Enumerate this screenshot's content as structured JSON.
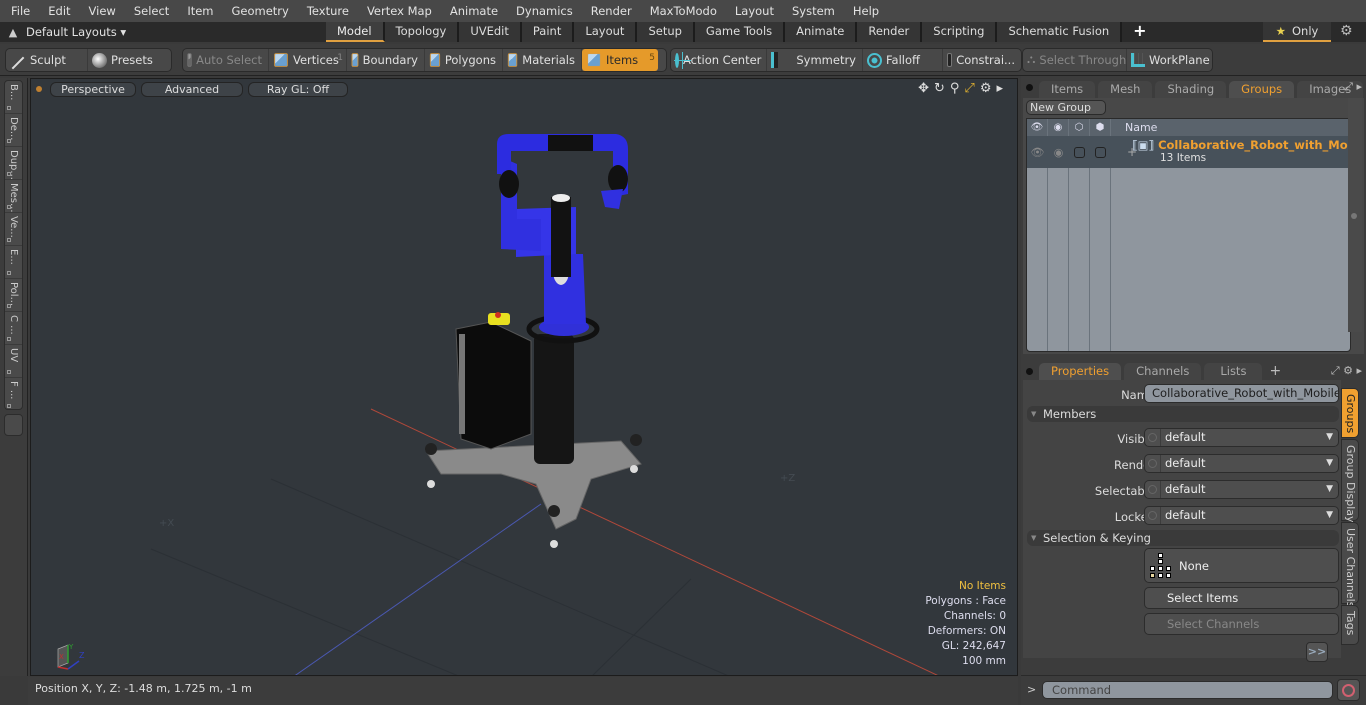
{
  "menubar": {
    "items": [
      "File",
      "Edit",
      "View",
      "Select",
      "Item",
      "Geometry",
      "Texture",
      "Vertex Map",
      "Animate",
      "Dynamics",
      "Render",
      "MaxToModo",
      "Layout",
      "System",
      "Help"
    ]
  },
  "layoutbar": {
    "layouts_label": "Default Layouts ▾",
    "tabs": [
      {
        "label": "Model",
        "active": true
      },
      {
        "label": "Topology"
      },
      {
        "label": "UVEdit"
      },
      {
        "label": "Paint"
      },
      {
        "label": "Layout"
      },
      {
        "label": "Setup"
      },
      {
        "label": "Game Tools"
      },
      {
        "label": "Animate"
      },
      {
        "label": "Render"
      },
      {
        "label": "Scripting"
      },
      {
        "label": "Schematic Fusion"
      }
    ],
    "add_tab": "+",
    "only_label": "Only",
    "star_icon": "★"
  },
  "toolbar": {
    "sculpt": "Sculpt",
    "presets": "Presets",
    "auto_select": "Auto Select",
    "vertices": "Vertices",
    "vertices_count": "1",
    "boundary": "Boundary",
    "polygons": "Polygons",
    "materials": "Materials",
    "items": "Items",
    "items_count": "5",
    "action_center": "Action Center",
    "symmetry": "Symmetry",
    "falloff": "Falloff",
    "constraints": "Constrai...",
    "select_through": "Select Through",
    "workplane": "WorkPlane"
  },
  "left_tabs": [
    "B...",
    "De...",
    "Dup...",
    "Mes...",
    "Ve...",
    "E...",
    "Pol...",
    "C ...",
    "UV",
    "F ..."
  ],
  "viewport": {
    "view_mode": "Perspective",
    "shading": "Advanced",
    "raygl": "Ray GL: Off",
    "axis_x_label": "+X",
    "axis_z_label": "+Z",
    "info": {
      "selection": "No Items",
      "polygons": "Polygons : Face",
      "channels": "Channels: 0",
      "deformers": "Deformers: ON",
      "gl": "GL: 242,647",
      "unit": "100 mm"
    },
    "model_colors": {
      "arm": "#3030e0",
      "base": "#8a8a8a",
      "column": "#1a1a1a",
      "estop": "#e8e020"
    }
  },
  "statusbar": {
    "position": "Position X, Y, Z:   -1.48 m, 1.725 m, -1 m"
  },
  "groups_panel": {
    "tabs": [
      {
        "label": "Items"
      },
      {
        "label": "Mesh ..."
      },
      {
        "label": "Shading"
      },
      {
        "label": "Groups",
        "active": true
      },
      {
        "label": "Images"
      }
    ],
    "add_tab": "+",
    "new_group": "New Group",
    "column_name": "Name",
    "rows": [
      {
        "name": "Collaborative_Robot_with_Mobi...",
        "sub": "13 Items"
      }
    ]
  },
  "properties_panel": {
    "tabs": [
      {
        "label": "Properties",
        "active": true
      },
      {
        "label": "Channels"
      },
      {
        "label": "Lists"
      }
    ],
    "add_tab": "+",
    "name_label": "Name",
    "name_value": "Collaborative_Robot_with_Mobile_Pec",
    "members_section": "Members",
    "fields": [
      {
        "label": "Visible",
        "value": "default"
      },
      {
        "label": "Render",
        "value": "default"
      },
      {
        "label": "Selectable",
        "value": "default"
      },
      {
        "label": "Locked",
        "value": "default"
      }
    ],
    "selection_section": "Selection & Keying",
    "none_label": "None",
    "select_items": "Select Items",
    "select_channels": "Select Channels",
    "more": ">>",
    "side_tabs": [
      {
        "label": "Groups",
        "active": true
      },
      {
        "label": "Group Display"
      },
      {
        "label": "User Channels"
      },
      {
        "label": "Tags"
      }
    ]
  },
  "command": {
    "prompt": ">",
    "placeholder": "Command"
  },
  "colors": {
    "accent": "#f0a030",
    "active_tool": "#e59a2a"
  }
}
